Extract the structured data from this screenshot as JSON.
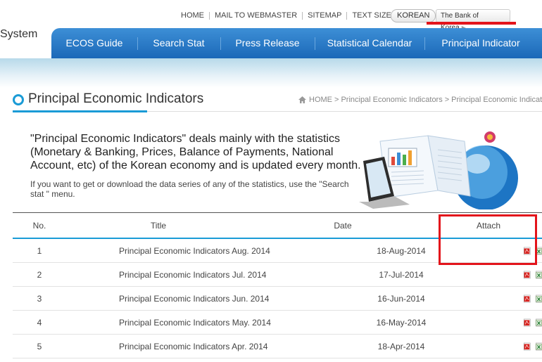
{
  "util": {
    "home": "HOME",
    "mail": "MAIL TO WEBMASTER",
    "sitemap": "SITEMAP",
    "textsize": "TEXT SIZE",
    "plus": "+",
    "minus": "−",
    "korean": "KOREAN",
    "bok": "The Bank of Korea"
  },
  "brand_partial": "System",
  "nav": [
    "ECOS Guide",
    "Search Stat",
    "Press Release",
    "Statistical Calendar",
    "Principal Indicator"
  ],
  "page_title": "Principal Economic Indicators",
  "breadcrumb": [
    "HOME",
    "Principal Economic Indicators",
    "Principal Economic Indicators"
  ],
  "intro": {
    "main": "\"Principal Economic Indicators\" deals mainly with the statistics (Monetary & Banking, Prices, Balance of Payments, National Account, etc) of the Korean economy and is updated every month.",
    "sub": "If you want to get or download the data series of any of the statistics, use the \"Search stat \" menu."
  },
  "table": {
    "headers": [
      "No.",
      "Title",
      "Date",
      "Attach"
    ],
    "rows": [
      {
        "no": "1",
        "title": "Principal Economic Indicators Aug. 2014",
        "date": "18-Aug-2014"
      },
      {
        "no": "2",
        "title": "Principal Economic Indicators Jul. 2014",
        "date": "17-Jul-2014"
      },
      {
        "no": "3",
        "title": "Principal Economic Indicators Jun. 2014",
        "date": "16-Jun-2014"
      },
      {
        "no": "4",
        "title": "Principal Economic Indicators May. 2014",
        "date": "16-May-2014"
      },
      {
        "no": "5",
        "title": "Principal Economic Indicators Apr. 2014",
        "date": "18-Apr-2014"
      }
    ]
  },
  "colors": {
    "accent": "#1a9bd6",
    "nav": "#1b68b8",
    "highlight": "#e3141b"
  }
}
